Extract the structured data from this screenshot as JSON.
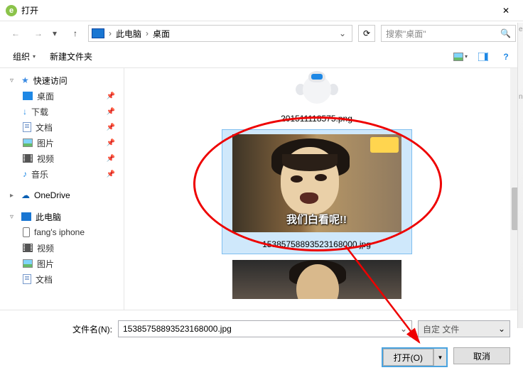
{
  "title": "打开",
  "close_glyph": "✕",
  "nav": {
    "back_glyph": "←",
    "forward_glyph": "→",
    "recent_caret": "▾",
    "up_glyph": "↑"
  },
  "path": {
    "root": "此电脑",
    "current": "桌面",
    "sep": "›",
    "dropdown_caret": "⌄",
    "refresh_glyph": "⟳"
  },
  "search": {
    "placeholder": "搜索\"桌面\"",
    "icon_glyph": "🔍"
  },
  "toolbar": {
    "organize": "组织",
    "new_folder": "新建文件夹",
    "caret": "▾",
    "help_glyph": "?"
  },
  "sidebar": {
    "quick_access": "快速访问",
    "items_pinned": [
      {
        "name": "desktop",
        "label": "桌面",
        "icon": "desktop"
      },
      {
        "name": "downloads",
        "label": "下载",
        "icon": "download"
      },
      {
        "name": "documents",
        "label": "文档",
        "icon": "doc"
      },
      {
        "name": "pictures",
        "label": "图片",
        "icon": "pic"
      },
      {
        "name": "videos",
        "label": "视频",
        "icon": "video"
      },
      {
        "name": "music",
        "label": "音乐",
        "icon": "music"
      }
    ],
    "onedrive": "OneDrive",
    "this_pc": "此电脑",
    "pc_children": [
      {
        "name": "iphone",
        "label": "fang's iphone",
        "icon": "phone"
      },
      {
        "name": "videos",
        "label": "视频",
        "icon": "video"
      },
      {
        "name": "pictures",
        "label": "图片",
        "icon": "pic"
      },
      {
        "name": "documents",
        "label": "文档",
        "icon": "doc"
      }
    ],
    "pin_glyph": "📌",
    "expander_open": "▿",
    "expander_closed": "▸"
  },
  "files": {
    "item1_caption": "201511118575.png",
    "item2_caption": "15385758893523168000.jpg",
    "item2_subtitle": "我们白看呢!!"
  },
  "footer": {
    "filename_label": "文件名(N):",
    "filename_value": "15385758893523168000.jpg",
    "filter_value": "自定   文件",
    "open_label": "打开(O)",
    "cancel_label": "取消",
    "combo_caret": "⌄",
    "split_caret": "▼"
  },
  "right_strip": {
    "e": "e",
    "n": "n"
  }
}
